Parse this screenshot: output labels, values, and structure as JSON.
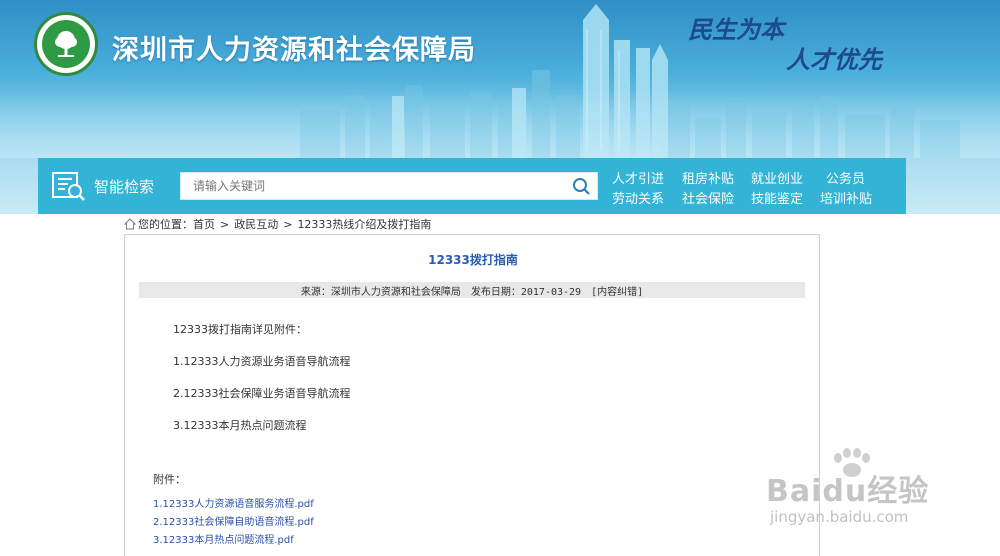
{
  "header": {
    "site_title": "深圳市人力资源和社会保障局",
    "slogan_line1": "民生为本",
    "slogan_line2": "人才优先",
    "logo_text": "深圳市人力资源和社会保障局"
  },
  "search": {
    "label": "智能检索",
    "placeholder": "请输入关键词"
  },
  "nav": {
    "items": [
      {
        "label": "人才引进"
      },
      {
        "label": "租房补贴"
      },
      {
        "label": "就业创业"
      },
      {
        "label": "公务员"
      },
      {
        "label": "劳动关系"
      },
      {
        "label": "社会保险"
      },
      {
        "label": "技能鉴定"
      },
      {
        "label": "培训补贴"
      }
    ]
  },
  "breadcrumb": {
    "prefix": "您的位置：",
    "items": [
      "首页",
      "政民互动",
      "12333热线介绍及拨打指南"
    ],
    "separator": ">"
  },
  "article": {
    "title": "12333拨打指南",
    "source": "来源：深圳市人力资源和社会保障局",
    "date": "发布日期：2017-03-29",
    "correction": "[内容纠错]",
    "paragraphs": [
      "12333拨打指南详见附件：",
      "1.12333人力资源业务语音导航流程",
      "2.12333社会保障业务语音导航流程",
      "3.12333本月热点问题流程"
    ],
    "attachments_label": "附件：",
    "attachments": [
      "1.12333人力资源语音服务流程.pdf",
      "2.12333社会保障自助语音流程.pdf",
      "3.12333本月热点问题流程.pdf"
    ]
  },
  "watermark": {
    "brand": "Baidu经验",
    "url": "jingyan.baidu.com"
  },
  "colors": {
    "banner_top": "#2f8fc6",
    "navbar": "#33b3d6",
    "title_blue": "#2a5db0",
    "link_blue": "#2a4fa8",
    "slogan": "#1c4a8c",
    "logo_green": "#2f9a44"
  }
}
